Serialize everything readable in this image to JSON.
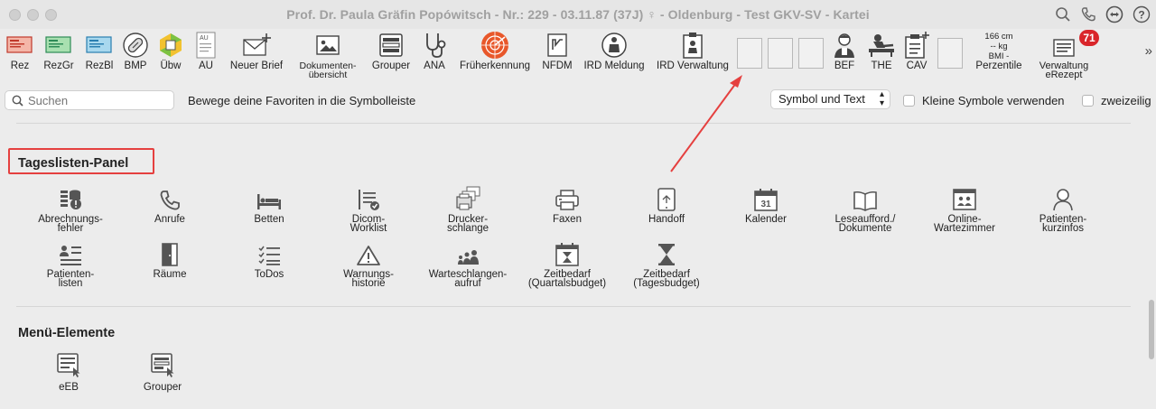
{
  "window": {
    "title": "Prof. Dr. Paula Gräfin Popówitsch - Nr.: 229 - 03.11.87 (37J) ♀ - Oldenburg - Test GKV-SV - Kartei"
  },
  "toolbar": {
    "rez": "Rez",
    "rezgr": "RezGr",
    "rezbl": "RezBl",
    "bmp": "BMP",
    "uebw": "Übw",
    "au": "AU",
    "au_icon_text": "AU",
    "neuer_brief": "Neuer Brief",
    "dokumente_l1": "Dokumenten-",
    "dokumente_l2": "übersicht",
    "grouper": "Grouper",
    "ana": "ANA",
    "frueherkennung": "Früherkennung",
    "nfdm": "NFDM",
    "ird_meldung": "IRD Meldung",
    "ird_verwaltung": "IRD Verwaltung",
    "bef": "BEF",
    "the": "THE",
    "cav": "CAV",
    "bmi_height": "166 cm",
    "bmi_weight": "-- kg",
    "bmi_label": "BMI -",
    "bmi_perzentile": "Perzentile",
    "erezept_badge": "71",
    "erezept_l1": "Verwaltung",
    "erezept_l2": "eRezept",
    "overflow": "»"
  },
  "favbar": {
    "search_placeholder": "Suchen",
    "hint": "Bewege deine Favoriten in die Symbolleiste",
    "display_mode": "Symbol und Text",
    "small_icons": "Kleine Symbole verwenden",
    "two_rows": "zweizeilig"
  },
  "tageslisten": {
    "title": "Tageslisten-Panel",
    "items": [
      {
        "l1": "Abrechnungs-",
        "l2": "fehler",
        "icon": "coins-alert-icon"
      },
      {
        "l1": "Anrufe",
        "l2": "",
        "icon": "phone-icon"
      },
      {
        "l1": "Betten",
        "l2": "",
        "icon": "bed-icon"
      },
      {
        "l1": "Dicom-",
        "l2": "Worklist",
        "icon": "checklist-icon"
      },
      {
        "l1": "Drucker-",
        "l2": "schlange",
        "icon": "printer-stack-icon"
      },
      {
        "l1": "Faxen",
        "l2": "",
        "icon": "fax-icon"
      },
      {
        "l1": "Handoff",
        "l2": "",
        "icon": "tablet-icon"
      },
      {
        "l1": "Kalender",
        "l2": "",
        "icon": "calendar-icon"
      },
      {
        "l1": "Leseaufford./",
        "l2": "Dokumente",
        "icon": "book-icon"
      },
      {
        "l1": "Online-",
        "l2": "Wartezimmer",
        "icon": "waiting-room-icon"
      },
      {
        "l1": "Patienten-",
        "l2": "kurzinfos",
        "icon": "person-icon"
      },
      {
        "l1": "Patienten-",
        "l2": "listen",
        "icon": "person-list-icon"
      },
      {
        "l1": "Räume",
        "l2": "",
        "icon": "door-icon"
      },
      {
        "l1": "ToDos",
        "l2": "",
        "icon": "todo-list-icon"
      },
      {
        "l1": "Warnungs-",
        "l2": "historie",
        "icon": "warning-icon"
      },
      {
        "l1": "Warteschlangen-",
        "l2": "aufruf",
        "icon": "queue-icon"
      },
      {
        "l1": "Zeitbedarf",
        "l2": "(Quartalsbudget)",
        "icon": "hourglass-calendar-icon"
      },
      {
        "l1": "Zeitbedarf",
        "l2": "(Tagesbudget)",
        "icon": "hourglass-icon"
      }
    ]
  },
  "menu": {
    "title": "Menü-Elemente",
    "items": [
      {
        "label": "eEB",
        "icon": "document-cursor-icon"
      },
      {
        "label": "Grouper",
        "icon": "grouper-icon"
      }
    ]
  },
  "colors": {
    "annotation_red": "#e5403f",
    "badge_red": "#d9252a",
    "icon_gray": "#555555"
  }
}
